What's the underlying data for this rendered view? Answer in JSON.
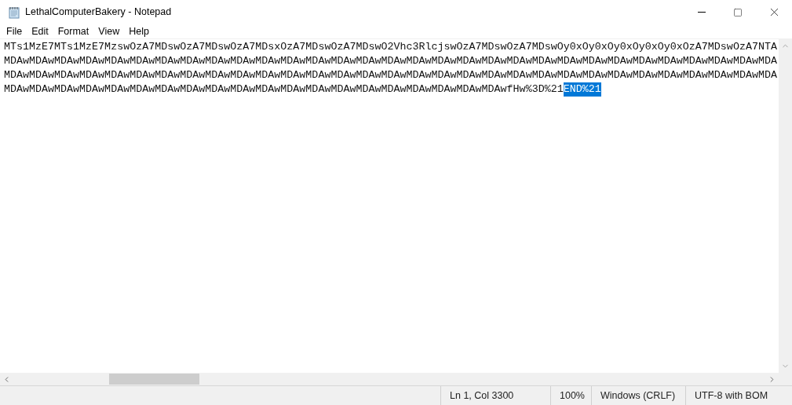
{
  "window": {
    "title": "LethalComputerBakery - Notepad"
  },
  "menu": [
    "File",
    "Edit",
    "Format",
    "View",
    "Help"
  ],
  "editor": {
    "lines": [
      {
        "text": "MTs1MzE7MTs1MzE7MzswOzA7MDswOzA7MDswOzA7MDsxOzA7MDswOzA7MDswO2Vhc3RlcjswOzA7MDswOzA7MDswOy0xOy0xOy0xOy0xOy0xOzA7MDswOzA7NTA"
      },
      {
        "text": "MDAwMDAwMDAwMDAwMDAwMDAwMDAwMDAwMDAwMDAwMDAwMDAwMDAwMDAwMDAwMDAwMDAwMDAwMDAwMDAwMDAwMDAwMDAwMDAwMDAwMDAwMDAwMDAwMDAwMDAwMDA"
      },
      {
        "text": "MDAwMDAwMDAwMDAwMDAwMDAwMDAwMDAwMDAwMDAwMDAwMDAwMDAwMDAwMDAwMDAwMDAwMDAwMDAwMDAwMDAwMDAwMDAwMDAwMDAwMDAwMDAwMDAwMDAwMDAwMDA"
      },
      {
        "text": "MDAwMDAwMDAwMDAwMDAwMDAwMDAwMDAwMDAwMDAwMDAwMDAwMDAwMDAwMDAwMDAwMDAwMDAwMDAwMDAwfHw%3D%21",
        "selected_text": "END%21"
      }
    ]
  },
  "status_bar": [
    "Ln 1, Col 3300",
    "100%",
    "Windows (CRLF)",
    "UTF-8 with BOM"
  ]
}
